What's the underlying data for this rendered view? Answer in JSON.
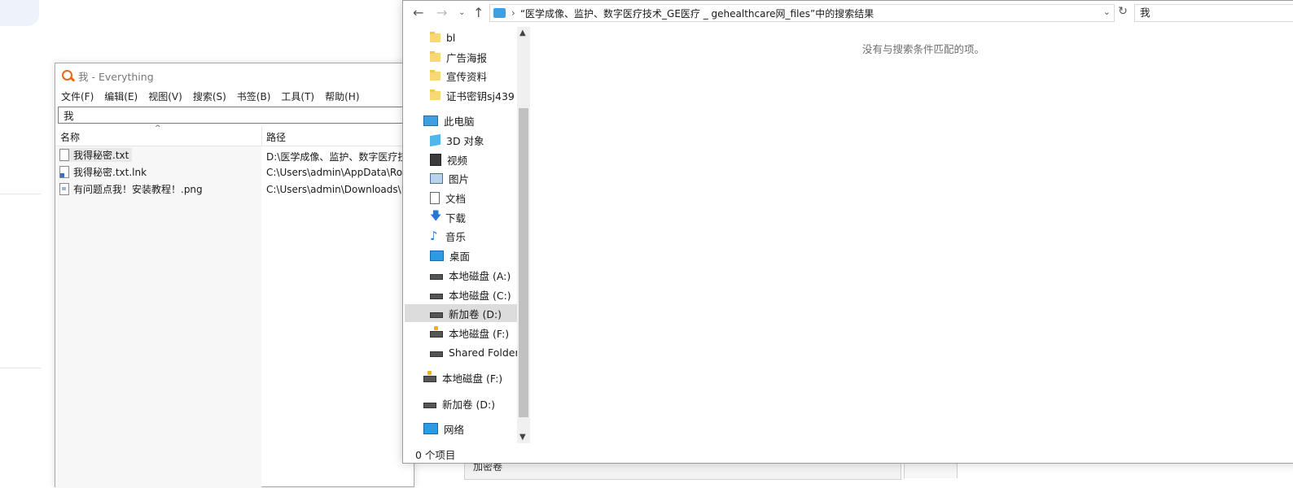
{
  "background": {
    "behind_window_label": "加密卷"
  },
  "everything": {
    "title": "我 - Everything",
    "menu": [
      "文件(F)",
      "编辑(E)",
      "视图(V)",
      "搜索(S)",
      "书签(B)",
      "工具(T)",
      "帮助(H)"
    ],
    "search_value": "我",
    "columns": {
      "name": "名称",
      "path": "路径"
    },
    "sort_indicator": "^",
    "rows": [
      {
        "name": "我得秘密.txt",
        "path": "D:\\医学成像、监护、数字医疗技",
        "icon": "text-file-icon"
      },
      {
        "name": "我得秘密.txt.lnk",
        "path": "C:\\Users\\admin\\AppData\\Roa",
        "icon": "shortcut-file-icon"
      },
      {
        "name": "有问题点我！安装教程！.png",
        "path": "C:\\Users\\admin\\Downloads\\K",
        "icon": "image-file-icon"
      }
    ]
  },
  "explorer": {
    "nav": {
      "back": "←",
      "forward": "→",
      "recent": "⌄",
      "up": "↑"
    },
    "address": "“医学成像、监护、数字医疗技术_GE医疗 _ gehealthcare网_files”中的搜索结果",
    "address_separator": "›",
    "address_dropdown": "⌄",
    "refresh": "↻",
    "search_value": "我",
    "tree": [
      {
        "label": "bl",
        "icon": "folder-icon"
      },
      {
        "label": "广告海报",
        "icon": "folder-icon"
      },
      {
        "label": "宣传资料",
        "icon": "folder-icon"
      },
      {
        "label": "证书密钥sj439",
        "icon": "folder-icon"
      },
      {
        "label": "此电脑",
        "icon": "computer-icon"
      },
      {
        "label": "3D 对象",
        "icon": "3d-objects-icon"
      },
      {
        "label": "视频",
        "icon": "video-icon"
      },
      {
        "label": "图片",
        "icon": "pictures-icon"
      },
      {
        "label": "文档",
        "icon": "documents-icon"
      },
      {
        "label": "下载",
        "icon": "download-icon"
      },
      {
        "label": "音乐",
        "icon": "music-icon"
      },
      {
        "label": "桌面",
        "icon": "desktop-icon"
      },
      {
        "label": "本地磁盘 (A:)",
        "icon": "drive-icon"
      },
      {
        "label": "本地磁盘 (C:)",
        "icon": "system-drive-icon"
      },
      {
        "label": "新加卷 (D:)",
        "icon": "drive-icon"
      },
      {
        "label": "本地磁盘 (F:)",
        "icon": "locked-drive-icon"
      },
      {
        "label": "Shared Folders",
        "icon": "network-drive-icon"
      },
      {
        "label": "本地磁盘 (F:)",
        "icon": "locked-drive-icon"
      },
      {
        "label": "新加卷 (D:)",
        "icon": "drive-icon"
      },
      {
        "label": "网络",
        "icon": "network-icon"
      }
    ],
    "empty_message": "没有与搜索条件匹配的项。",
    "status": "0 个项目"
  }
}
